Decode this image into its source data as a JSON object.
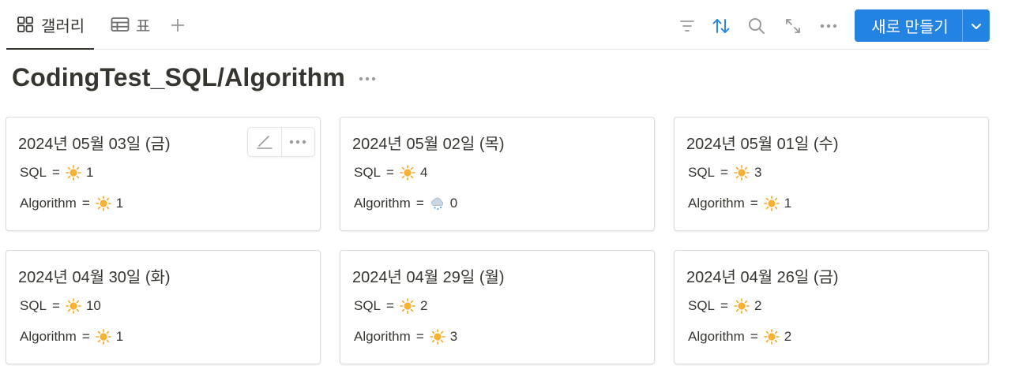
{
  "tabs": {
    "gallery_label": "갤러리",
    "table_label": "표"
  },
  "toolbar": {
    "new_label": "새로 만들기",
    "accent": "#2383e2",
    "icons": [
      "filter-icon",
      "sort-icon",
      "search-icon",
      "expand-icon",
      "more-icon"
    ]
  },
  "page": {
    "title": "CodingTest_SQL/Algorithm"
  },
  "cards": [
    {
      "title": "2024년 05월 03일 (금)",
      "sql_label": "SQL",
      "sql_icon": "sun-icon",
      "sql_value": "1",
      "algo_label": "Algorithm",
      "algo_icon": "sun-icon",
      "algo_value": "1"
    },
    {
      "title": "2024년 05월 02일 (목)",
      "sql_label": "SQL",
      "sql_icon": "sun-icon",
      "sql_value": "4",
      "algo_label": "Algorithm",
      "algo_icon": "cloud-snow-icon",
      "algo_value": "0"
    },
    {
      "title": "2024년 05월 01일 (수)",
      "sql_label": "SQL",
      "sql_icon": "sun-icon",
      "sql_value": "3",
      "algo_label": "Algorithm",
      "algo_icon": "sun-icon",
      "algo_value": "1"
    },
    {
      "title": "2024년 04월 30일 (화)",
      "sql_label": "SQL",
      "sql_icon": "sun-icon",
      "sql_value": "10",
      "algo_label": "Algorithm",
      "algo_icon": "sun-icon",
      "algo_value": "1"
    },
    {
      "title": "2024년 04월 29일 (월)",
      "sql_label": "SQL",
      "sql_icon": "sun-icon",
      "sql_value": "2",
      "algo_label": "Algorithm",
      "algo_icon": "sun-icon",
      "algo_value": "3"
    },
    {
      "title": "2024년 04월 26일 (금)",
      "sql_label": "SQL",
      "sql_icon": "sun-icon",
      "sql_value": "2",
      "algo_label": "Algorithm",
      "algo_icon": "sun-icon",
      "algo_value": "2"
    }
  ]
}
